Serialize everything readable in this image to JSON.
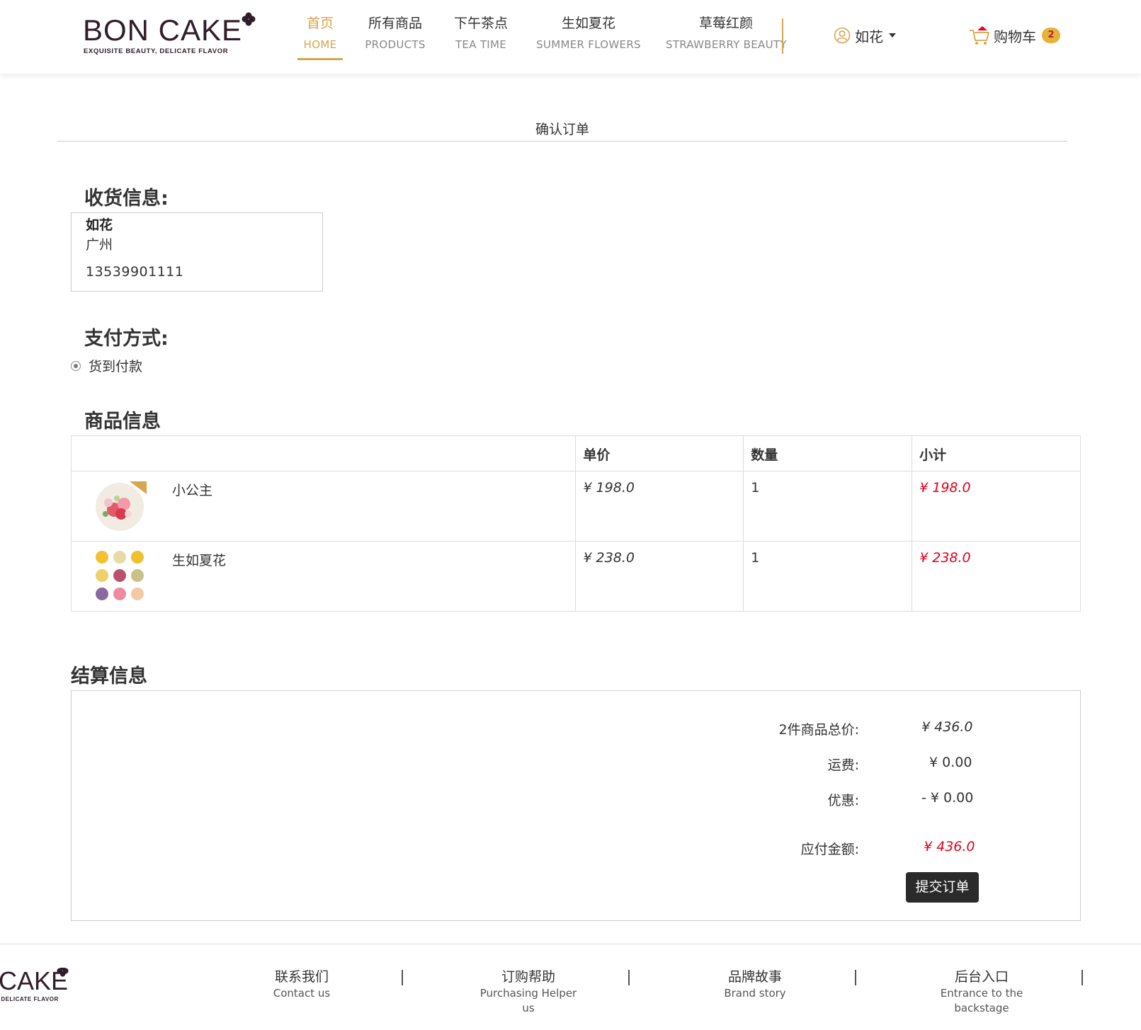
{
  "brand": {
    "name": "BON CAKE",
    "tagline": "EXQUISITE BEAUTY, DELICATE FLAVOR"
  },
  "nav": [
    {
      "cn": "首页",
      "en": "HOME",
      "active": true
    },
    {
      "cn": "所有商品",
      "en": "PRODUCTS",
      "active": false
    },
    {
      "cn": "下午茶点",
      "en": "TEA TIME",
      "active": false
    },
    {
      "cn": "生如夏花",
      "en": "SUMMER FLOWERS",
      "active": false
    },
    {
      "cn": "草莓红颜",
      "en": "STRAWBERRY BEAUTY",
      "active": false
    }
  ],
  "user": {
    "name": "如花",
    "icon": "user-circle-icon"
  },
  "cart": {
    "label": "购物车",
    "count": "2",
    "icon": "shopping-cart-icon"
  },
  "page_title": "确认订单",
  "shipping": {
    "heading": "收货信息:",
    "name": "如花",
    "city": "广州",
    "phone": "13539901111"
  },
  "payment": {
    "heading": "支付方式:",
    "option": "货到付款",
    "selected": true
  },
  "products": {
    "heading": "商品信息",
    "columns": [
      "",
      "单价",
      "数量",
      "小计"
    ],
    "rows": [
      {
        "name": "小公主",
        "price": "¥ 198.0",
        "qty": "1",
        "subtotal": "¥ 198.0",
        "image": "cake-princess-image"
      },
      {
        "name": "生如夏花",
        "price": "¥ 238.0",
        "qty": "1",
        "subtotal": "¥ 238.0",
        "image": "cake-flowers-image"
      }
    ]
  },
  "settlement": {
    "heading": "结算信息",
    "total_label": "2件商品总价:",
    "total_value": "¥ 436.0",
    "shipping_label": "运费:",
    "shipping_value": "¥ 0.00",
    "discount_label": "优惠:",
    "discount_value": "- ¥ 0.00",
    "payable_label": "应付金额:",
    "payable_value": "¥ 436.0",
    "submit_label": "提交订单"
  },
  "footer": {
    "brand": {
      "name": "BON CAKE",
      "tagline": "EXQUISITE BEAUTY, DELICATE FLAVOR"
    },
    "links": [
      {
        "cn": "联系我们",
        "en": "Contact us"
      },
      {
        "cn": "订购帮助",
        "en": "Purchasing Helper us"
      },
      {
        "cn": "品牌故事",
        "en": "Brand story"
      },
      {
        "cn": "后台入口",
        "en": "Entrance to the backstage"
      }
    ]
  },
  "colors": {
    "accent": "#d6a54e",
    "price_red": "#e3001b",
    "button_dark": "#2a2a2a",
    "badge": "#e7b13c"
  }
}
